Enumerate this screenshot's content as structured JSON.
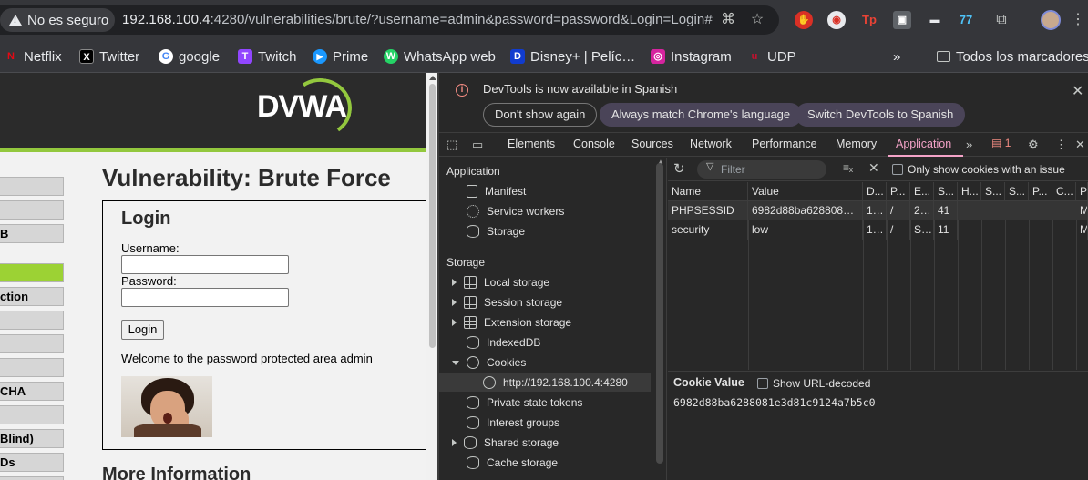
{
  "browser": {
    "security_chip": "No es seguro",
    "url_host": "192.168.100.4",
    "url_rest": ":4280/vulnerabilities/brute/?username=admin&password=password&Login=Login#"
  },
  "bookmarks": [
    {
      "label": "Netflix",
      "icon": "netflix-icon",
      "color": "#e50914",
      "glyph": "N"
    },
    {
      "label": "Twitter",
      "icon": "x-icon",
      "color": "#000000",
      "glyph": "X"
    },
    {
      "label": "google",
      "icon": "google-icon",
      "color": "#4285f4",
      "glyph": "G"
    },
    {
      "label": "Twitch",
      "icon": "twitch-icon",
      "color": "#9146ff",
      "glyph": "T"
    },
    {
      "label": "Prime",
      "icon": "prime-icon",
      "color": "#1a98ff",
      "glyph": "▶"
    },
    {
      "label": "WhatsApp web",
      "icon": "whatsapp-icon",
      "color": "#25d366",
      "glyph": "W"
    },
    {
      "label": "Disney+ | Pelíc…",
      "icon": "disney-icon",
      "color": "#113ccf",
      "glyph": "D"
    },
    {
      "label": "Instagram",
      "icon": "instagram-icon",
      "color": "#d6249f",
      "glyph": "◎"
    },
    {
      "label": "UDP",
      "icon": "udp-icon",
      "color": "#c8102e",
      "glyph": "u"
    }
  ],
  "bookmarks_more": "»",
  "bookmarks_folder": "Todos los marcadores",
  "dvwa": {
    "logo": "DVWA",
    "menu": [
      "",
      "",
      "B",
      "",
      "",
      "ction",
      "",
      "",
      "",
      "CHA",
      "",
      "Blind)",
      "Ds"
    ],
    "active_menu_index": 3,
    "title": "Vulnerability: Brute Force",
    "login_heading": "Login",
    "username_label": "Username:",
    "password_label": "Password:",
    "login_button": "Login",
    "welcome": "Welcome to the password protected area admin",
    "more_info": "More Information"
  },
  "devtools": {
    "info_text": "DevTools is now available in Spanish",
    "btn_dont_show": "Don't show again",
    "btn_match": "Always match Chrome's language",
    "btn_switch": "Switch DevTools to Spanish",
    "tabs": [
      "Elements",
      "Console",
      "Sources",
      "Network",
      "Performance",
      "Memory",
      "Application"
    ],
    "active_tab": "Application",
    "issues_count": "1",
    "sidebar": {
      "application_header": "Application",
      "manifest": "Manifest",
      "service_workers": "Service workers",
      "storage_item": "Storage",
      "storage_header": "Storage",
      "local_storage": "Local storage",
      "session_storage": "Session storage",
      "extension_storage": "Extension storage",
      "indexeddb": "IndexedDB",
      "cookies": "Cookies",
      "cookie_origin": "http://192.168.100.4:4280",
      "private_state_tokens": "Private state tokens",
      "interest_groups": "Interest groups",
      "shared_storage": "Shared storage",
      "cache_storage": "Cache storage"
    },
    "cookies_toolbar": {
      "filter_placeholder": "Filter",
      "only_issue": "Only show cookies with an issue"
    },
    "cookie_columns": [
      "Name",
      "Value",
      "D...",
      "P...",
      "E...",
      "S...",
      "H...",
      "S...",
      "S...",
      "P...",
      "C...",
      "P"
    ],
    "cookie_rows": [
      [
        "PHPSESSID",
        "6982d88ba628808…",
        "1…",
        "/",
        "2…",
        "41",
        "",
        "",
        "",
        "",
        "",
        "M"
      ],
      [
        "security",
        "low",
        "1…",
        "/",
        "S…",
        "11",
        "",
        "",
        "",
        "",
        "",
        "M"
      ]
    ],
    "cookie_value_title": "Cookie Value",
    "show_url_decoded": "Show URL-decoded",
    "cookie_value": "6982d88ba6288081e3d81c9124a7b5c0"
  }
}
